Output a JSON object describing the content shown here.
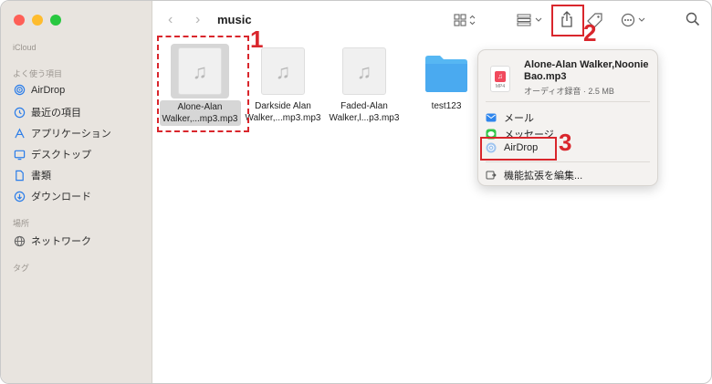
{
  "window": {
    "title": "music",
    "nav_back": "‹",
    "nav_forward": "›"
  },
  "sidebar": {
    "sections": [
      {
        "title": "iCloud",
        "items": []
      },
      {
        "title": "よく使う項目",
        "items": [
          {
            "label": "AirDrop",
            "icon": "airdrop-icon"
          },
          {
            "label": "最近の項目",
            "icon": "clock-icon"
          },
          {
            "label": "アプリケーション",
            "icon": "applications-icon"
          },
          {
            "label": "デスクトップ",
            "icon": "desktop-icon"
          },
          {
            "label": "書類",
            "icon": "document-icon"
          },
          {
            "label": "ダウンロード",
            "icon": "download-icon"
          }
        ]
      },
      {
        "title": "場所",
        "items": [
          {
            "label": "ネットワーク",
            "icon": "network-icon"
          }
        ]
      },
      {
        "title": "タグ",
        "items": []
      }
    ]
  },
  "files": [
    {
      "name_line1": "Alone-Alan",
      "name_line2": "Walker,...mp3.mp3",
      "type": "audio",
      "selected": true
    },
    {
      "name_line1": "Darkside Alan",
      "name_line2": "Walker,...mp3.mp3",
      "type": "audio",
      "selected": false
    },
    {
      "name_line1": "Faded-Alan",
      "name_line2": "Walker,l...p3.mp3",
      "type": "audio",
      "selected": false
    },
    {
      "name_line1": "test123",
      "name_line2": "",
      "type": "folder",
      "selected": false
    }
  ],
  "share_menu": {
    "file_title": "Alone-Alan Walker,Noonie Bao.mp3",
    "file_subtitle": "オーディオ録音 · 2.5 MB",
    "file_icon_ext": "MP4",
    "items": [
      {
        "label": "メール",
        "icon": "mail-icon"
      },
      {
        "label": "メッセージ",
        "icon": "messages-icon"
      },
      {
        "label": "AirDrop",
        "icon": "airdrop-icon"
      },
      {
        "label": "機能拡張を編集...",
        "icon": "extensions-icon"
      }
    ]
  },
  "callouts": [
    "1",
    "2",
    "3"
  ],
  "colors": {
    "sidebar_bg": "#e8e4df",
    "accent": "#d9262c",
    "folder": "#56b7f3"
  }
}
